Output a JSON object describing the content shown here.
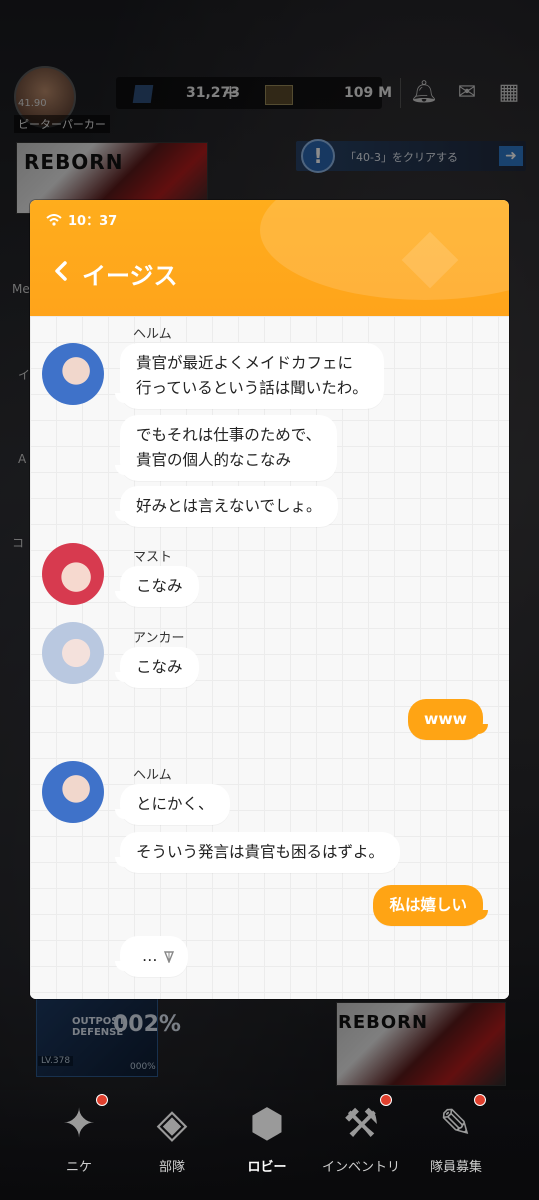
{
  "lobby": {
    "player_level": "41.90",
    "player_name": "ピーターパーカー",
    "gems": "31,273",
    "gems_plus": "+",
    "credits": "109 M",
    "banner_top_text": "REBORN",
    "quest_text": "「40-3」をクリアする",
    "quest_alert": "!",
    "side_labels": [
      "Me",
      "イ",
      "A",
      "コ"
    ],
    "outpost": {
      "title_line1": "OUTPOST",
      "title_line2": "DEFENSE",
      "percent": "002%",
      "level": "LV.378",
      "sub_percent": "000%"
    },
    "banner_bottom_text": "REBORN",
    "nav": [
      {
        "label": "ニケ",
        "icon": "nikke-icon"
      },
      {
        "label": "部隊",
        "icon": "squad-icon"
      },
      {
        "label": "ロビー",
        "icon": "lobby-icon"
      },
      {
        "label": "インベントリ",
        "icon": "inventory-icon"
      },
      {
        "label": "隊員募集",
        "icon": "recruit-icon"
      }
    ]
  },
  "chat": {
    "time": "10：37",
    "title": "イージス",
    "messages": [
      {
        "sender": "ヘルム",
        "text": "貴官が最近よくメイドカフェに\n行っているという話は聞いたわ。"
      },
      {
        "text": "でもそれは仕事のためで、\n貴官の個人的なこなみ"
      },
      {
        "text": "好みとは言えないでしょ。"
      },
      {
        "sender": "マスト",
        "text": "こなみ"
      },
      {
        "sender": "アンカー",
        "text": "こなみ"
      },
      {
        "mine": true,
        "text": "www"
      },
      {
        "sender": "ヘルム",
        "text": "とにかく、"
      },
      {
        "text": "そういう発言は貴官も困るはずよ。"
      },
      {
        "mine": true,
        "text": "私は嬉しい"
      },
      {
        "typing": true,
        "text": "…"
      }
    ]
  },
  "colors": {
    "accent": "#ffa414",
    "header": "#ffad1c"
  }
}
